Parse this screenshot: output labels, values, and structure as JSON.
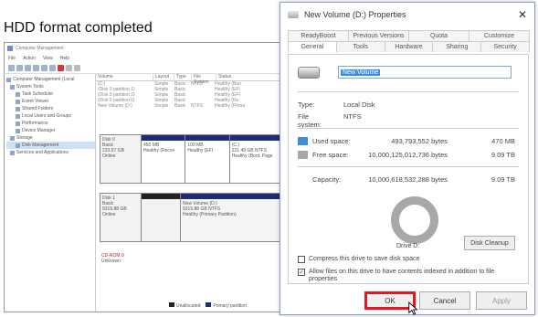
{
  "caption": "HDD format completed",
  "computer_management": {
    "title": "Computer Management",
    "menu": [
      "File",
      "Action",
      "View",
      "Help"
    ],
    "tree": [
      "Computer Management (Local",
      "System Tools",
      "Task Scheduler",
      "Event Viewer",
      "Shared Folders",
      "Local Users and Groups",
      "Performance",
      "Device Manager",
      "Storage",
      "Disk Management",
      "Services and Applications"
    ],
    "columns": [
      "Volume",
      "Layout",
      "Type",
      "File System",
      "Status"
    ],
    "rows": [
      [
        "(C:)",
        "Simple",
        "Basic",
        "NTFS",
        "Healthy (Boo"
      ],
      [
        "(Disk 0 partition 1)",
        "Simple",
        "Basic",
        "",
        "Healthy (EFI"
      ],
      [
        "(Disk 0 partition 2)",
        "Simple",
        "Basic",
        "",
        "Healthy (EFI"
      ],
      [
        "(Disk 0 partition 5)",
        "Simple",
        "Basic",
        "",
        "Healthy (Re"
      ],
      [
        "New Volume (D:)",
        "Simple",
        "Basic",
        "NTFS",
        "Healthy (Prima"
      ]
    ],
    "disks": [
      {
        "label": "Disk 0",
        "sub": "Basic",
        "size": "223.57 GB",
        "state": "Online",
        "parts": [
          "450 MB\nHealthy (Recov",
          "100 MB\nHealthy (EFI",
          "(C:)\n221.48 GB NTFS\nHealthy (Boot, Page"
        ]
      },
      {
        "label": "Disk 1",
        "sub": "Basic",
        "size": "9315.88 GB",
        "state": "Online",
        "parts": [
          "",
          "New Volume (D:)\n9315.88 GB NTFS\nHealthy (Primary Partition)"
        ]
      },
      {
        "label": "CD-ROM 0",
        "sub": "Unknown",
        "size": "",
        "state": "",
        "parts": []
      }
    ],
    "legend": [
      "Unallocated",
      "Primary partition"
    ]
  },
  "dialog": {
    "title": "New Volume (D:) Properties",
    "close": "✕",
    "tabs_row1": [
      "ReadyBoost",
      "Previous Versions",
      "Quota",
      "Customize"
    ],
    "tabs_row2": [
      "General",
      "Tools",
      "Hardware",
      "Sharing",
      "Security"
    ],
    "volume_name": "New Volume",
    "type_label": "Type:",
    "type_value": "Local Disk",
    "fs_label": "File system:",
    "fs_value": "NTFS",
    "used_label": "Used space:",
    "used_bytes": "493,793,552 bytes",
    "used_human": "470 MB",
    "free_label": "Free space:",
    "free_bytes": "10,000,125,012,736 bytes",
    "free_human": "9.09 TB",
    "cap_label": "Capacity:",
    "cap_bytes": "10,000,618,532,288 bytes",
    "cap_human": "9.09 TB",
    "drive_caption": "Drive D:",
    "cleanup": "Disk Cleanup",
    "compress": "Compress this drive to save disk space",
    "index": "Allow files on this drive to have contents indexed in addition to file properties",
    "ok": "OK",
    "cancel": "Cancel",
    "apply": "Apply",
    "colors": {
      "used": "#3f8fd6",
      "free": "#a8a8a8",
      "highlight": "#e5161d"
    }
  }
}
